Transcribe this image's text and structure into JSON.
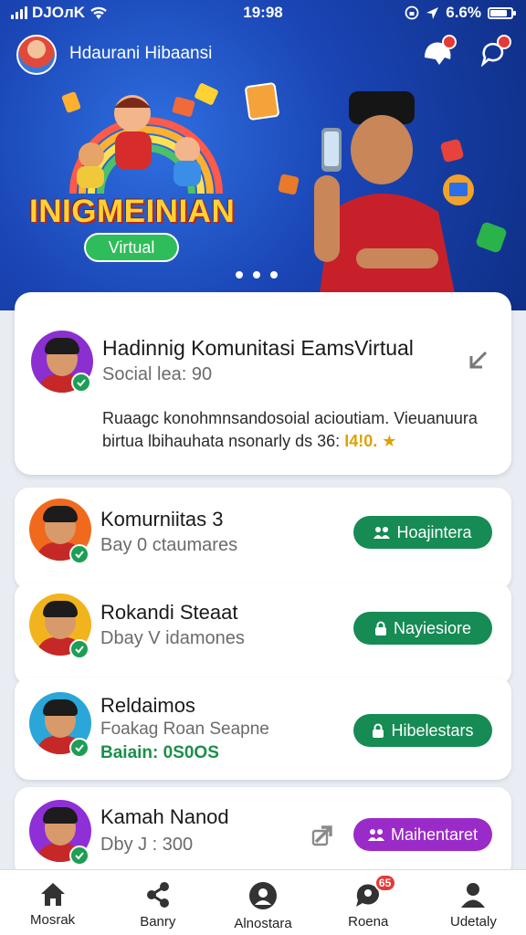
{
  "status_bar": {
    "carrier": "DJOлK",
    "time": "19:98",
    "battery": "6.6%"
  },
  "header": {
    "profile_name": "Hdaurani Hibaansi"
  },
  "promo": {
    "title": "INIGMEINIAN",
    "pill_label": "Virtual",
    "slide_count": 3,
    "active_slide": 1
  },
  "featured": {
    "title": "Hadinnig Komunitasi EamsVirtual",
    "subtitle": "Social lea: 90",
    "description": "Ruaagc konohmnsandosoial acioutiam. Vieuanuura birtua lbihauhata nsonarly ds 36:",
    "highlight": "I4!0."
  },
  "groups": [
    {
      "title": "Komurniitas 3",
      "subtitle": "Bay 0 ctaumares",
      "button": "Hoajintera",
      "button_icon": "group-icon",
      "color": "#168b54"
    },
    {
      "title": "Rokandi Steaat",
      "subtitle": "Dbay V idamones",
      "button": "Nayiesiore",
      "button_icon": "lock-icon",
      "color": "#168b54"
    },
    {
      "title": "Reldaimos",
      "subtitle": "Foakag Roan Seapne",
      "price": "Baiain: 0S0OS",
      "button": "Hibelestars",
      "button_icon": "lock-icon",
      "color": "#168b54"
    },
    {
      "title": "Kamah Nanod",
      "subtitle": "Dby J : 300",
      "button": "Maihentaret",
      "button_icon": "group-icon",
      "color": "#9b2bc9"
    }
  ],
  "bottom_nav": [
    {
      "label": "Mosrak",
      "icon": "home-icon"
    },
    {
      "label": "Banry",
      "icon": "share-icon"
    },
    {
      "label": "Alnostara",
      "icon": "profile-circle-icon"
    },
    {
      "label": "Roena",
      "icon": "chat-icon",
      "badge": "65"
    },
    {
      "label": "Udetaly",
      "icon": "user-icon"
    }
  ]
}
